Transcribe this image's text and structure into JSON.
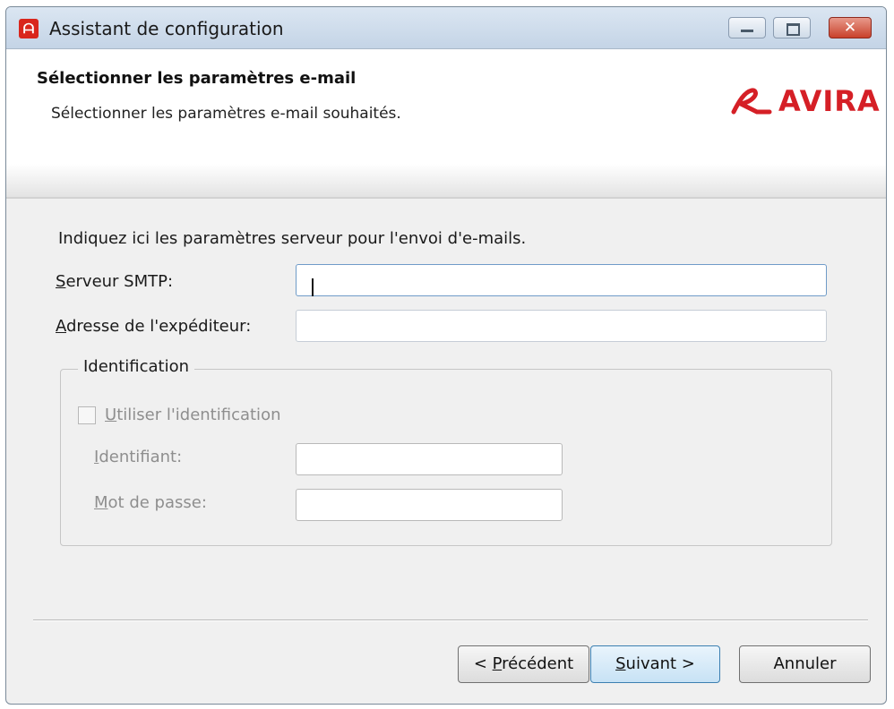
{
  "window": {
    "title": "Assistant de configuration",
    "app_icon_glyph": "ᗩ",
    "close_glyph": "✕"
  },
  "header": {
    "title": "Sélectionner les paramètres e-mail",
    "subtitle": "Sélectionner les paramètres e-mail souhaités.",
    "logo_text": "AVIRA",
    "logo_color": "#d51f26"
  },
  "form": {
    "intro": "Indiquez ici les paramètres serveur pour l'envoi d'e-mails.",
    "smtp": {
      "label_access": "S",
      "label_rest": "erveur SMTP:",
      "value": ""
    },
    "sender": {
      "label_access": "A",
      "label_rest": "dresse de l'expéditeur:",
      "value": ""
    },
    "identification": {
      "legend": "Identification",
      "use_auth": {
        "label_access": "U",
        "label_rest": "tiliser l'identification",
        "checked": false
      },
      "username": {
        "label_access": "I",
        "label_rest": "dentifiant:",
        "value": ""
      },
      "password": {
        "label_access": "M",
        "label_rest": "ot de passe:",
        "value": ""
      }
    }
  },
  "buttons": {
    "prev": {
      "pre": "< ",
      "access": "P",
      "rest": "récédent"
    },
    "next": {
      "access": "S",
      "rest": "uivant >"
    },
    "cancel": {
      "label": "Annuler"
    }
  }
}
